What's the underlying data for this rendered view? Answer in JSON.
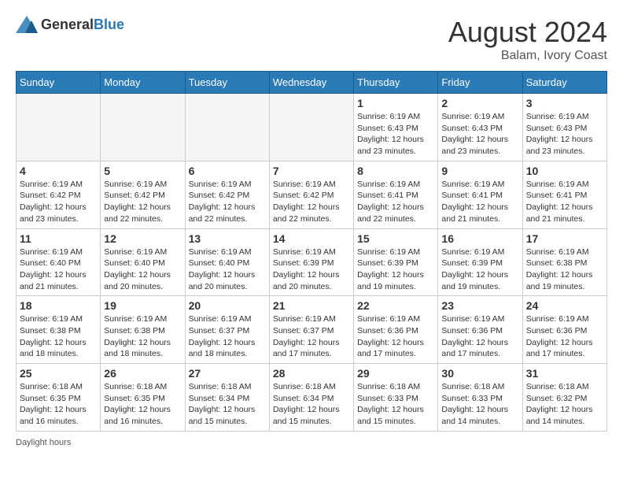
{
  "header": {
    "logo_general": "General",
    "logo_blue": "Blue",
    "month_year": "August 2024",
    "location": "Balam, Ivory Coast"
  },
  "calendar": {
    "days_of_week": [
      "Sunday",
      "Monday",
      "Tuesday",
      "Wednesday",
      "Thursday",
      "Friday",
      "Saturday"
    ],
    "weeks": [
      {
        "days": [
          {
            "number": "",
            "info": ""
          },
          {
            "number": "",
            "info": ""
          },
          {
            "number": "",
            "info": ""
          },
          {
            "number": "",
            "info": ""
          },
          {
            "number": "1",
            "info": "Sunrise: 6:19 AM\nSunset: 6:43 PM\nDaylight: 12 hours and 23 minutes."
          },
          {
            "number": "2",
            "info": "Sunrise: 6:19 AM\nSunset: 6:43 PM\nDaylight: 12 hours and 23 minutes."
          },
          {
            "number": "3",
            "info": "Sunrise: 6:19 AM\nSunset: 6:43 PM\nDaylight: 12 hours and 23 minutes."
          }
        ]
      },
      {
        "days": [
          {
            "number": "4",
            "info": "Sunrise: 6:19 AM\nSunset: 6:42 PM\nDaylight: 12 hours and 23 minutes."
          },
          {
            "number": "5",
            "info": "Sunrise: 6:19 AM\nSunset: 6:42 PM\nDaylight: 12 hours and 22 minutes."
          },
          {
            "number": "6",
            "info": "Sunrise: 6:19 AM\nSunset: 6:42 PM\nDaylight: 12 hours and 22 minutes."
          },
          {
            "number": "7",
            "info": "Sunrise: 6:19 AM\nSunset: 6:42 PM\nDaylight: 12 hours and 22 minutes."
          },
          {
            "number": "8",
            "info": "Sunrise: 6:19 AM\nSunset: 6:41 PM\nDaylight: 12 hours and 22 minutes."
          },
          {
            "number": "9",
            "info": "Sunrise: 6:19 AM\nSunset: 6:41 PM\nDaylight: 12 hours and 21 minutes."
          },
          {
            "number": "10",
            "info": "Sunrise: 6:19 AM\nSunset: 6:41 PM\nDaylight: 12 hours and 21 minutes."
          }
        ]
      },
      {
        "days": [
          {
            "number": "11",
            "info": "Sunrise: 6:19 AM\nSunset: 6:40 PM\nDaylight: 12 hours and 21 minutes."
          },
          {
            "number": "12",
            "info": "Sunrise: 6:19 AM\nSunset: 6:40 PM\nDaylight: 12 hours and 20 minutes."
          },
          {
            "number": "13",
            "info": "Sunrise: 6:19 AM\nSunset: 6:40 PM\nDaylight: 12 hours and 20 minutes."
          },
          {
            "number": "14",
            "info": "Sunrise: 6:19 AM\nSunset: 6:39 PM\nDaylight: 12 hours and 20 minutes."
          },
          {
            "number": "15",
            "info": "Sunrise: 6:19 AM\nSunset: 6:39 PM\nDaylight: 12 hours and 19 minutes."
          },
          {
            "number": "16",
            "info": "Sunrise: 6:19 AM\nSunset: 6:39 PM\nDaylight: 12 hours and 19 minutes."
          },
          {
            "number": "17",
            "info": "Sunrise: 6:19 AM\nSunset: 6:38 PM\nDaylight: 12 hours and 19 minutes."
          }
        ]
      },
      {
        "days": [
          {
            "number": "18",
            "info": "Sunrise: 6:19 AM\nSunset: 6:38 PM\nDaylight: 12 hours and 18 minutes."
          },
          {
            "number": "19",
            "info": "Sunrise: 6:19 AM\nSunset: 6:38 PM\nDaylight: 12 hours and 18 minutes."
          },
          {
            "number": "20",
            "info": "Sunrise: 6:19 AM\nSunset: 6:37 PM\nDaylight: 12 hours and 18 minutes."
          },
          {
            "number": "21",
            "info": "Sunrise: 6:19 AM\nSunset: 6:37 PM\nDaylight: 12 hours and 17 minutes."
          },
          {
            "number": "22",
            "info": "Sunrise: 6:19 AM\nSunset: 6:36 PM\nDaylight: 12 hours and 17 minutes."
          },
          {
            "number": "23",
            "info": "Sunrise: 6:19 AM\nSunset: 6:36 PM\nDaylight: 12 hours and 17 minutes."
          },
          {
            "number": "24",
            "info": "Sunrise: 6:19 AM\nSunset: 6:36 PM\nDaylight: 12 hours and 17 minutes."
          }
        ]
      },
      {
        "days": [
          {
            "number": "25",
            "info": "Sunrise: 6:18 AM\nSunset: 6:35 PM\nDaylight: 12 hours and 16 minutes."
          },
          {
            "number": "26",
            "info": "Sunrise: 6:18 AM\nSunset: 6:35 PM\nDaylight: 12 hours and 16 minutes."
          },
          {
            "number": "27",
            "info": "Sunrise: 6:18 AM\nSunset: 6:34 PM\nDaylight: 12 hours and 15 minutes."
          },
          {
            "number": "28",
            "info": "Sunrise: 6:18 AM\nSunset: 6:34 PM\nDaylight: 12 hours and 15 minutes."
          },
          {
            "number": "29",
            "info": "Sunrise: 6:18 AM\nSunset: 6:33 PM\nDaylight: 12 hours and 15 minutes."
          },
          {
            "number": "30",
            "info": "Sunrise: 6:18 AM\nSunset: 6:33 PM\nDaylight: 12 hours and 14 minutes."
          },
          {
            "number": "31",
            "info": "Sunrise: 6:18 AM\nSunset: 6:32 PM\nDaylight: 12 hours and 14 minutes."
          }
        ]
      }
    ],
    "footer_label": "Daylight hours"
  }
}
